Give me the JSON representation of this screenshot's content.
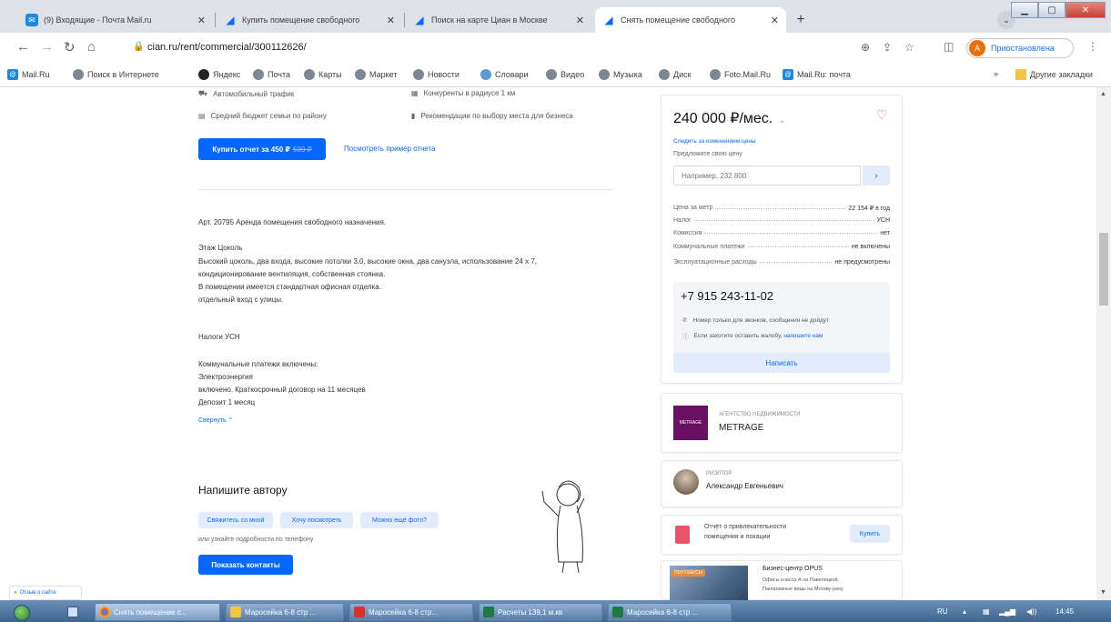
{
  "tabs": [
    {
      "title": "(9) Входящие - Почта Mail.ru",
      "icon": "mail-icon"
    },
    {
      "title": "Купить помещение свободного",
      "icon": "cian-icon"
    },
    {
      "title": "Поиск на карте Циан в Москве",
      "icon": "cian-icon"
    },
    {
      "title": "Снять помещение свободного",
      "icon": "cian-icon"
    }
  ],
  "address": {
    "url": "cian.ru/rent/commercial/300112626/"
  },
  "profile": {
    "initial": "A",
    "status": "Приостановлена"
  },
  "bookmarks": [
    "Mail.Ru",
    "Поиск в Интернете",
    "Яндекс",
    "Почта",
    "Карты",
    "Маркет",
    "Новости",
    "Словари",
    "Видео",
    "Музыка",
    "Диск",
    "Foto.Mail.Ru",
    "Mail.Ru: почта"
  ],
  "bookmarks_other": "Другие закладки",
  "report": {
    "features": [
      "Автомобильный трафик",
      "Конкуренты в радиусе 1 км",
      "Средний бюджет семьи по району",
      "Рекомендации по выбору места для бизнеса"
    ],
    "buy_label": "Купить отчет за 450 ₽",
    "buy_old_price": "500 ₽",
    "example_link": "Посмотреть пример отчета"
  },
  "description": {
    "art": "Арт. 20795 Аренда помещения свободного назначения.",
    "lines1": [
      "Этаж Цоколь",
      "Высокий цоколь, два входа, высокие потолки 3.0, высокие окна, два санузла, использование 24 х 7,",
      "кондиционирование вентиляция, собственная стоянка.",
      "В помещении имеется стандартная офисная отделка.",
      " отдельный вход с улицы."
    ],
    "tax": "Налоги УСН",
    "lines2": [
      "Коммунальные платежи включены:",
      "Электроэнергия",
      "включено. Краткосрочный договор на 11 месяцев",
      "Депозит 1 месяц"
    ],
    "collapse": "Свернуть"
  },
  "author": {
    "heading": "Напишите автору",
    "chips": [
      "Свяжитесь со мной",
      "Хочу посмотреть",
      "Можно ещё фото?"
    ],
    "note": "или узнайте подробности по телефону",
    "contacts_button": "Показать контакты"
  },
  "card": {
    "price": "240 000 ₽/мес.",
    "track": "Следить за изменением цены",
    "offer_label": "Предложите свою цену",
    "offer_placeholder": "Например, 232 800",
    "rows": [
      {
        "k": "Цена за метр",
        "v": "22 154 ₽ в год"
      },
      {
        "k": "Налог",
        "v": "УСН"
      },
      {
        "k": "Комиссия",
        "v": "нет"
      },
      {
        "k": "Коммунальные платежи",
        "v": "не включены"
      },
      {
        "k": "Эксплуатационные расходы",
        "v": "не предусмотрены"
      }
    ],
    "phone": "+7 915 243-11-02",
    "phone_note1": "Номер только для звонков, сообщения не дойдут",
    "phone_note2": "Если захотите оставить жалобу,",
    "phone_note2_link": "напишите нам",
    "write_button": "Написать"
  },
  "agency": {
    "caption": "АГЕНТСТВО НЕДВИЖИМОСТИ",
    "name": "METRAGE",
    "logo": "METRAGE"
  },
  "realtor": {
    "caption": "РИЭЛТОР",
    "name": "Александр Евгеньевич"
  },
  "attract": {
    "line1": "Отчёт о привлекательности",
    "line2": "помещения и локации",
    "buy": "Купить"
  },
  "bc": {
    "badge": "ПЕНТХАУСЫ",
    "title": "Бизнес-центр OPUS",
    "line1": "Офисы класса А на Павелецкой.",
    "line2": "Панорамные виды на Москву-реку."
  },
  "review": "Отзыв о сайте",
  "taskbar": {
    "items": [
      "Снять помещение с...",
      "Маросейка 6-8 стр ...",
      "Маросейка 6-8 стр...",
      "Расчеты 139,1 м.кв",
      "Маросейка 6-8 стр ..."
    ],
    "lang": "RU",
    "clock": "14:45"
  },
  "colors": {
    "accent": "#0468ff",
    "agency": "#6a0f64"
  }
}
